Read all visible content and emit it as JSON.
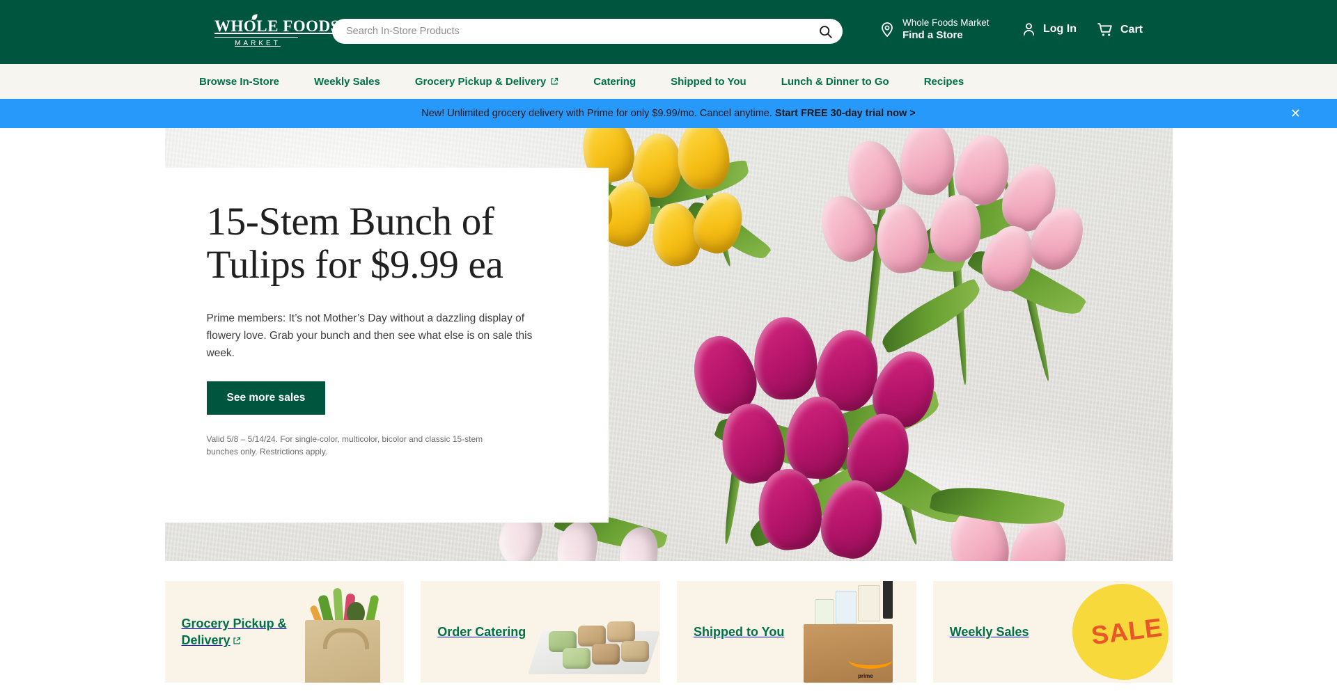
{
  "header": {
    "logo": {
      "top": "WHOLE FOODS",
      "bottom": "MARKET",
      "icon": "wfm-logo"
    },
    "search": {
      "placeholder": "Search In-Store Products",
      "value": "",
      "icon": "search-icon"
    },
    "store": {
      "icon": "location-pin-icon",
      "name": "Whole Foods Market",
      "action": "Find a Store"
    },
    "login": {
      "icon": "user-icon",
      "label": "Log In"
    },
    "cart": {
      "icon": "cart-icon",
      "label": "Cart"
    },
    "background_color": "#00553e"
  },
  "nav": {
    "background_color": "#f7f5f0",
    "link_color": "#00704a",
    "items": [
      {
        "label": "Browse In-Store",
        "external": false
      },
      {
        "label": "Weekly Sales",
        "external": false
      },
      {
        "label": "Grocery Pickup & Delivery",
        "external": true
      },
      {
        "label": "Catering",
        "external": false
      },
      {
        "label": "Shipped to You",
        "external": false
      },
      {
        "label": "Lunch & Dinner to Go",
        "external": false
      },
      {
        "label": "Recipes",
        "external": false
      }
    ]
  },
  "promo_banner": {
    "background_color": "#2699fb",
    "text": "New! Unlimited grocery delivery with Prime for only $9.99/mo. Cancel anytime. ",
    "cta": "Start FREE 30-day trial now >",
    "close_icon": "close-icon"
  },
  "hero": {
    "title": "15-Stem Bunch of Tulips for $9.99 ea",
    "description": "Prime members: It’s not Mother’s Day without a dazzling display of flowery love. Grab your bunch and then see what else is on sale this week.",
    "button_label": "See more sales",
    "button_color": "#00553e",
    "legal": "Valid 5/8 – 5/14/24. For single-color, multicolor, bicolor and classic 15-stem bunches only. Restrictions apply.",
    "image_alt": "tulip-bouquet-photo"
  },
  "cards": {
    "background_color": "#faf3e8",
    "items": [
      {
        "label": "Grocery Pickup & Delivery",
        "external": true,
        "art": "grocery-bag-art"
      },
      {
        "label": "Order Catering",
        "external": false,
        "art": "catering-wraps-art"
      },
      {
        "label": "Shipped to You",
        "external": false,
        "art": "amazon-box-art"
      },
      {
        "label": "Weekly Sales",
        "external": false,
        "art": "sale-splat-art"
      }
    ]
  }
}
